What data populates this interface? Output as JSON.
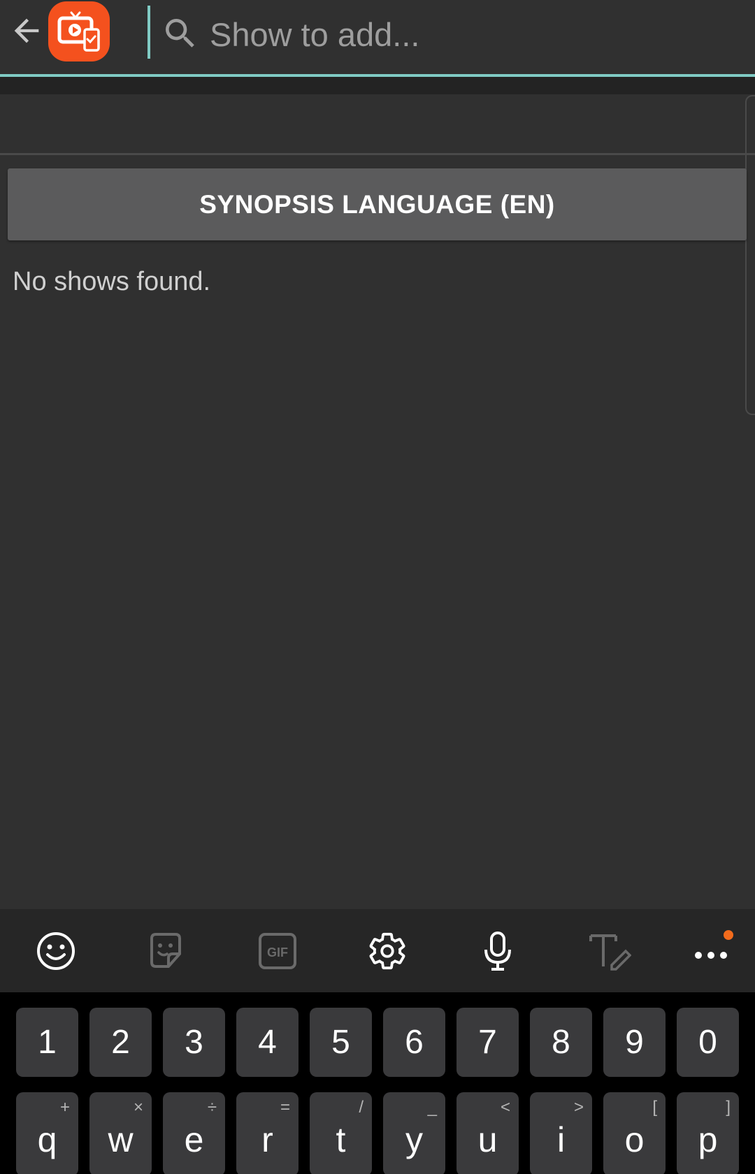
{
  "search": {
    "placeholder": "Show to add..."
  },
  "language_button": {
    "label": "SYNOPSIS LANGUAGE (EN)"
  },
  "results": {
    "empty_message": "No shows found."
  },
  "keyboard_toolbar": {
    "items": [
      "emoji-icon",
      "sticker-icon",
      "gif-icon",
      "settings-icon",
      "microphone-icon",
      "handwriting-icon",
      "more-icon"
    ],
    "gif_label": "GIF"
  },
  "keyboard": {
    "number_row": [
      "1",
      "2",
      "3",
      "4",
      "5",
      "6",
      "7",
      "8",
      "9",
      "0"
    ],
    "letter_row": [
      {
        "key": "q",
        "hint": "+"
      },
      {
        "key": "w",
        "hint": "×"
      },
      {
        "key": "e",
        "hint": "÷"
      },
      {
        "key": "r",
        "hint": "="
      },
      {
        "key": "t",
        "hint": "/"
      },
      {
        "key": "y",
        "hint": "_"
      },
      {
        "key": "u",
        "hint": "<"
      },
      {
        "key": "i",
        "hint": ">"
      },
      {
        "key": "o",
        "hint": "["
      },
      {
        "key": "p",
        "hint": "]"
      }
    ]
  },
  "colors": {
    "background": "#303030",
    "accent_teal": "#80cbc4",
    "app_icon": "#f4511e",
    "notification_dot": "#f36b1c"
  }
}
